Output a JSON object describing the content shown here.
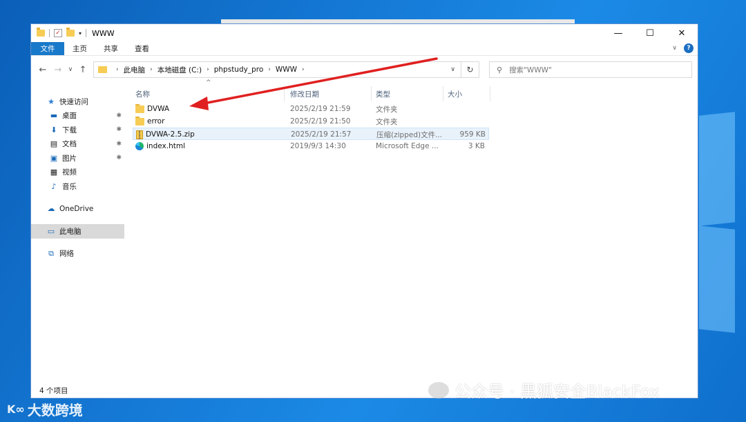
{
  "window": {
    "title": "WWW",
    "controls": {
      "minimize": "—",
      "maximize": "☐",
      "close": "✕"
    }
  },
  "ribbon": {
    "tabs": [
      "文件",
      "主页",
      "共享",
      "查看"
    ],
    "help": "?"
  },
  "navigation": {
    "back": "←",
    "forward": "→",
    "recent": "∨",
    "up": "↑",
    "breadcrumb": [
      "此电脑",
      "本地磁盘 (C:)",
      "phpstudy_pro",
      "WWW"
    ],
    "refresh": "↻",
    "search_placeholder": "搜索\"WWW\""
  },
  "sidebar": {
    "quick_access": "快速访问",
    "items": [
      {
        "label": "桌面",
        "icon": "desktop-icon",
        "pinned": true
      },
      {
        "label": "下载",
        "icon": "download-icon",
        "pinned": true
      },
      {
        "label": "文档",
        "icon": "document-icon",
        "pinned": true
      },
      {
        "label": "图片",
        "icon": "picture-icon",
        "pinned": true
      },
      {
        "label": "视频",
        "icon": "video-icon",
        "pinned": false
      },
      {
        "label": "音乐",
        "icon": "music-icon",
        "pinned": false
      }
    ],
    "onedrive": "OneDrive",
    "this_pc": "此电脑",
    "network": "网络"
  },
  "columns": {
    "name": "名称",
    "modified": "修改日期",
    "type": "类型",
    "size": "大小"
  },
  "files": [
    {
      "name": "DVWA",
      "modified": "2025/2/19 21:59",
      "type": "文件夹",
      "size": "",
      "icon": "folder-icon"
    },
    {
      "name": "error",
      "modified": "2025/2/19 21:50",
      "type": "文件夹",
      "size": "",
      "icon": "folder-icon"
    },
    {
      "name": "DVWA-2.5.zip",
      "modified": "2025/2/19 21:57",
      "type": "压缩(zipped)文件...",
      "size": "959 KB",
      "icon": "zip-icon",
      "selected": true
    },
    {
      "name": "index.html",
      "modified": "2019/9/3 14:30",
      "type": "Microsoft Edge ...",
      "size": "3 KB",
      "icon": "edge-icon"
    }
  ],
  "status": {
    "item_count": "4 个项目"
  },
  "watermarks": {
    "left": "大数跨境",
    "right": "公众号 · 黑狐安全BlackFox"
  },
  "colors": {
    "accent": "#1979ca",
    "arrow": "#e02020",
    "folder": "#f7cc55"
  }
}
